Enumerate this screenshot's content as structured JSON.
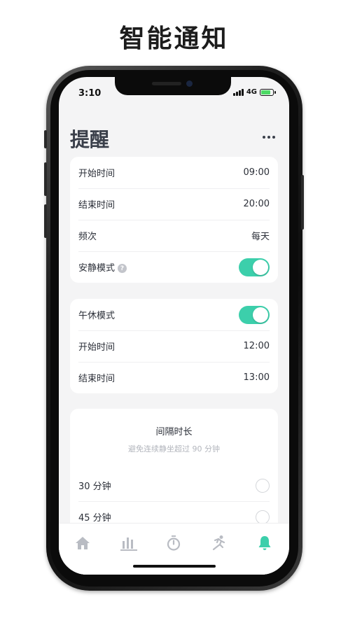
{
  "promo": {
    "title": "智能通知"
  },
  "status_bar": {
    "time": "3:10",
    "network": "4G"
  },
  "page": {
    "title": "提醒"
  },
  "reminder_card": {
    "start_label": "开始时间",
    "start_value": "09:00",
    "end_label": "结束时间",
    "end_value": "20:00",
    "freq_label": "频次",
    "freq_value": "每天",
    "quiet_label": "安静模式",
    "quiet_help": "?",
    "quiet_on": true
  },
  "nap_card": {
    "nap_label": "午休模式",
    "nap_on": true,
    "start_label": "开始时间",
    "start_value": "12:00",
    "end_label": "结束时间",
    "end_value": "13:00"
  },
  "interval_card": {
    "title": "间隔时长",
    "subtitle": "避免连续静坐超过 90 分钟",
    "options": [
      {
        "label": "30 分钟",
        "selected": false
      },
      {
        "label": "45 分钟",
        "selected": false
      }
    ]
  },
  "tabbar": {
    "active": "reminder",
    "tabs": [
      "home-icon",
      "stats-icon",
      "timer-icon",
      "running-icon",
      "bell-icon"
    ]
  },
  "colors": {
    "accent": "#3ccfab",
    "inactive_icon": "#b9bcc3"
  }
}
